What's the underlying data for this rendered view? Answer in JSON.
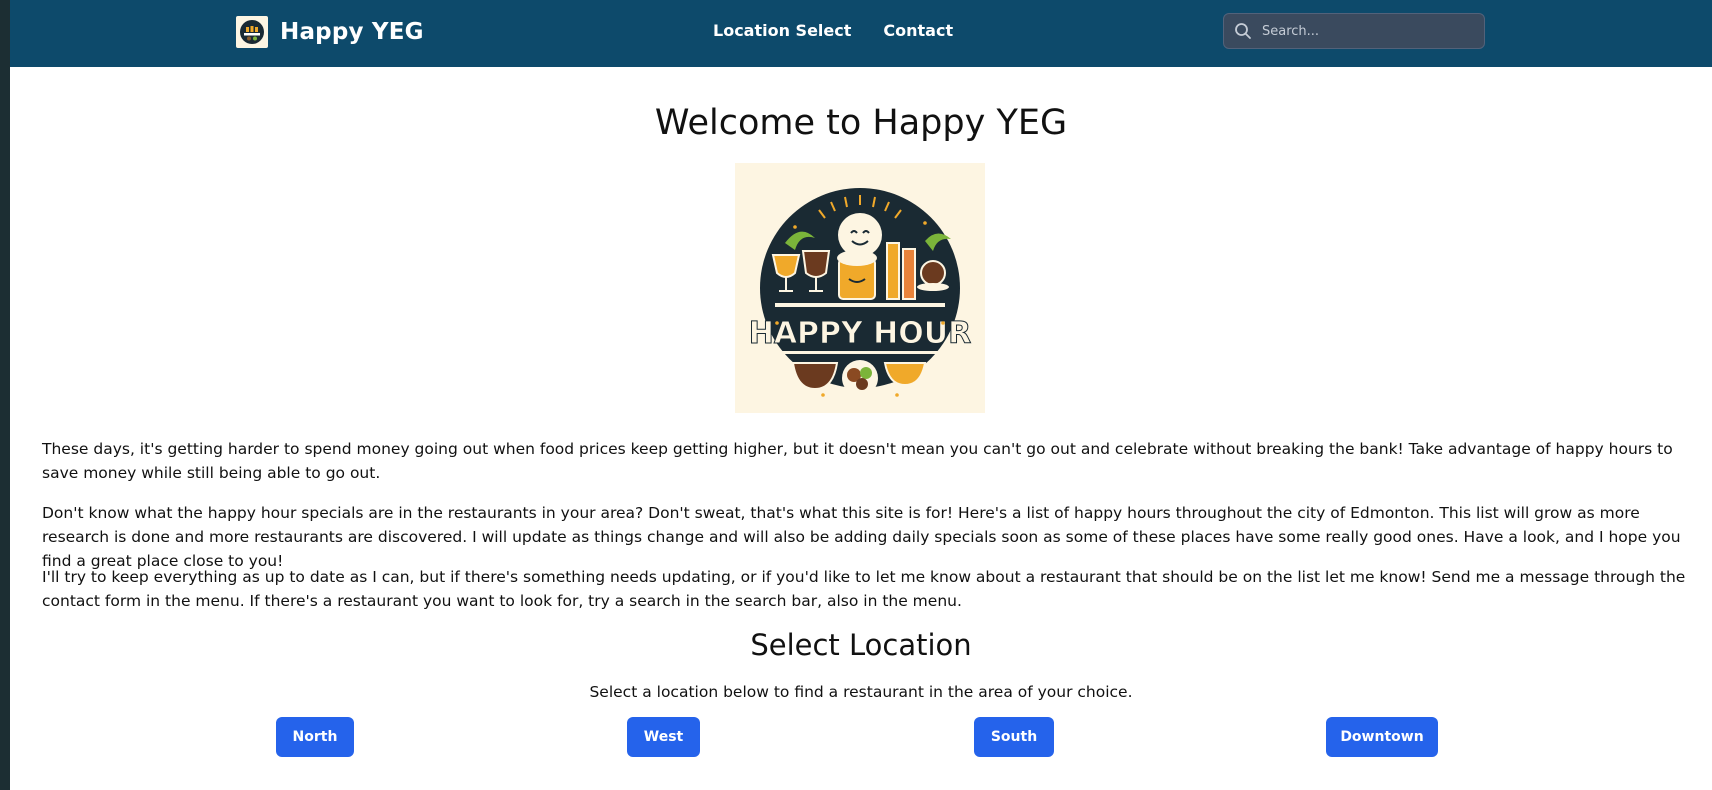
{
  "header": {
    "brand_title": "Happy YEG",
    "nav": [
      {
        "label": "Location Select"
      },
      {
        "label": "Contact"
      }
    ],
    "search": {
      "placeholder": "Search..."
    }
  },
  "main": {
    "title": "Welcome to Happy YEG",
    "logo_text": "HAPPY HOUR",
    "paragraphs": [
      "These days, it's getting harder to spend money going out when food prices keep getting higher, but it doesn't mean you can't go out and celebrate without breaking the bank! Take advantage of happy hours to save money while still being able to go out.",
      "Don't know what the happy hour specials are in the restaurants in your area? Don't sweat, that's what this site is for! Here's a list of happy hours throughout the city of Edmonton. This list will grow as more research is done and more restaurants are discovered. I will update as things change and will also be adding daily specials soon as some of these places have some really good ones. Have a look, and I hope you find a great place close to you!",
      "I'll try to keep everything as up to date as I can, but if there's something needs updating, or if you'd like to let me know about a restaurant that should be on the list let me know! Send me a message through the contact form in the menu. If there's a restaurant you want to look for, try a search in the search bar, also in the menu."
    ],
    "select_title": "Select Location",
    "select_subtitle": "Select a location below to find a restaurant in the area of your choice.",
    "locations": [
      {
        "label": "North"
      },
      {
        "label": "West"
      },
      {
        "label": "South"
      },
      {
        "label": "Downtown"
      }
    ]
  },
  "colors": {
    "navbar": "#0d4a6b",
    "button": "#2563eb",
    "logo_dark": "#1a2a33",
    "logo_cream": "#fdf5e2",
    "logo_gold": "#f0a92a"
  }
}
